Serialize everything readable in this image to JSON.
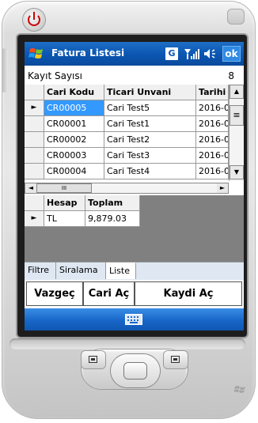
{
  "titlebar": {
    "title": "Fatura Listesi",
    "g_badge": "G",
    "ok_label": "ok",
    "icons": [
      "windows-flag-icon",
      "signal-icon",
      "volume-icon"
    ]
  },
  "record_count": {
    "label": "Kayıt Sayısı",
    "value": "8"
  },
  "grid": {
    "columns": [
      "Cari Kodu",
      "Ticari Unvani",
      "Tarihi"
    ],
    "rows": [
      {
        "code": "CR00005",
        "name": "Cari Test5",
        "date": "2016-0",
        "current": true
      },
      {
        "code": "CR00001",
        "name": "Cari Test1",
        "date": "2016-0",
        "current": false
      },
      {
        "code": "CR00002",
        "name": "Cari Test2",
        "date": "2016-0",
        "current": false
      },
      {
        "code": "CR00003",
        "name": "Cari Test3",
        "date": "2016-0",
        "current": false
      },
      {
        "code": "CR00004",
        "name": "Cari Test4",
        "date": "2016-0",
        "current": false
      }
    ],
    "row_indicator": "►",
    "scroll_up": "▲",
    "scroll_down": "▼",
    "scroll_grip": "≡",
    "scroll_left": "◄",
    "scroll_right": "►",
    "hthumb_grip": "III"
  },
  "summary": {
    "columns": [
      "Hesap",
      "Toplam"
    ],
    "rows": [
      {
        "account": "TL",
        "total": "9,879.03"
      }
    ]
  },
  "tabs": [
    "Filtre",
    "Siralama",
    "Liste"
  ],
  "active_tab": "Liste",
  "actions": {
    "cancel": "Vazgeç",
    "open_account": "Cari Aç",
    "open_record": "Kaydi Aç"
  },
  "colors": {
    "titlebar": "#0b57b3",
    "selection": "#3399ff",
    "selected_text": "#ffffff",
    "softbar": "#1866c8"
  }
}
